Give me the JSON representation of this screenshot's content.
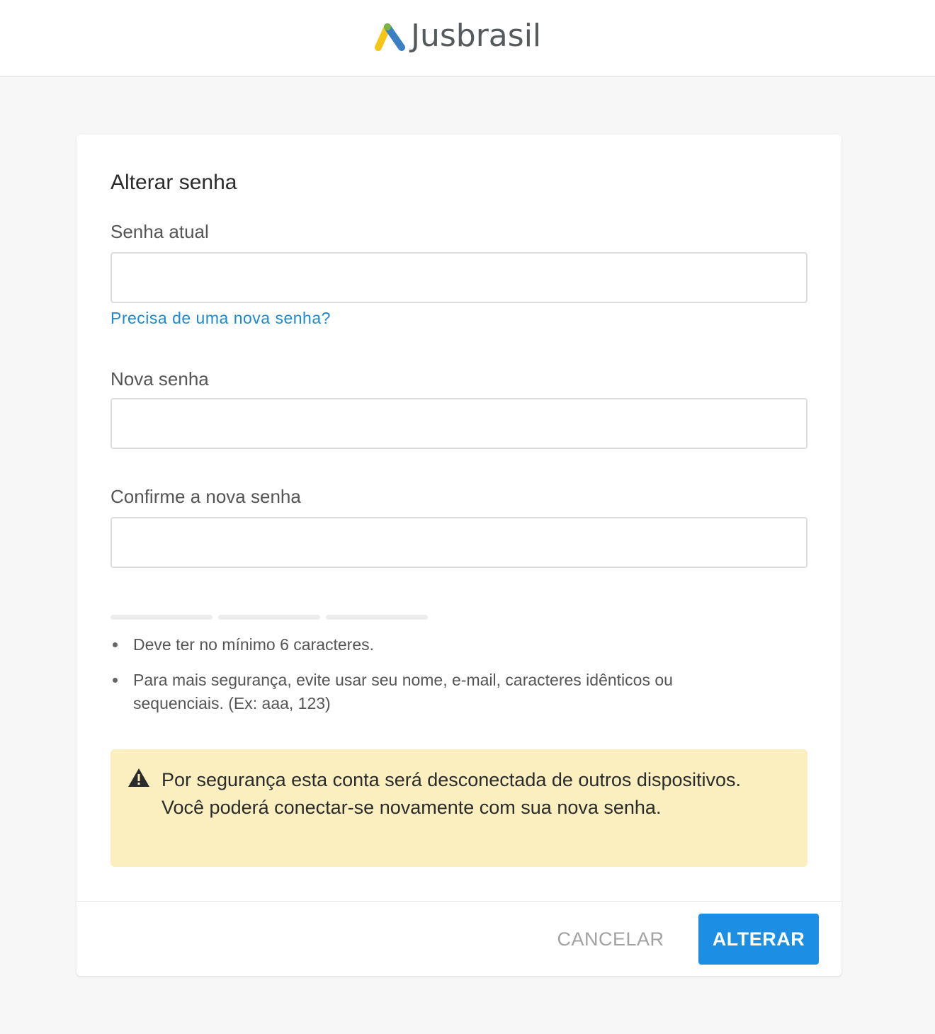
{
  "header": {
    "logo_text": "Jusbrasil",
    "logo_icon": "jusbrasil-logo-icon",
    "logo_colors": [
      "#f5c518",
      "#7cb342",
      "#3a7fc4"
    ]
  },
  "form": {
    "title": "Alterar senha",
    "current_password": {
      "label": "Senha atual",
      "value": "",
      "placeholder": ""
    },
    "forgot_link": "Precisa de uma nova senha?",
    "new_password": {
      "label": "Nova senha",
      "value": "",
      "placeholder": ""
    },
    "confirm_password": {
      "label": "Confirme a nova senha",
      "value": "",
      "placeholder": ""
    },
    "strength_meter": {
      "segments": 3,
      "filled": 0
    },
    "rules": [
      "Deve ter no mínimo 6 caracteres.",
      "Para mais segurança, evite usar seu nome, e-mail, caracteres idênticos ou sequenciais. (Ex: aaa, 123)"
    ],
    "alert": {
      "icon": "warning-icon",
      "text": "Por segurança esta conta será desconectada de outros dispositivos. Você poderá conectar-se novamente com sua nova senha."
    }
  },
  "actions": {
    "cancel_label": "CANCELAR",
    "submit_label": "ALTERAR"
  },
  "colors": {
    "accent": "#1c8fe4",
    "link": "#1a8ad6",
    "alert_bg": "#fcefbf"
  }
}
